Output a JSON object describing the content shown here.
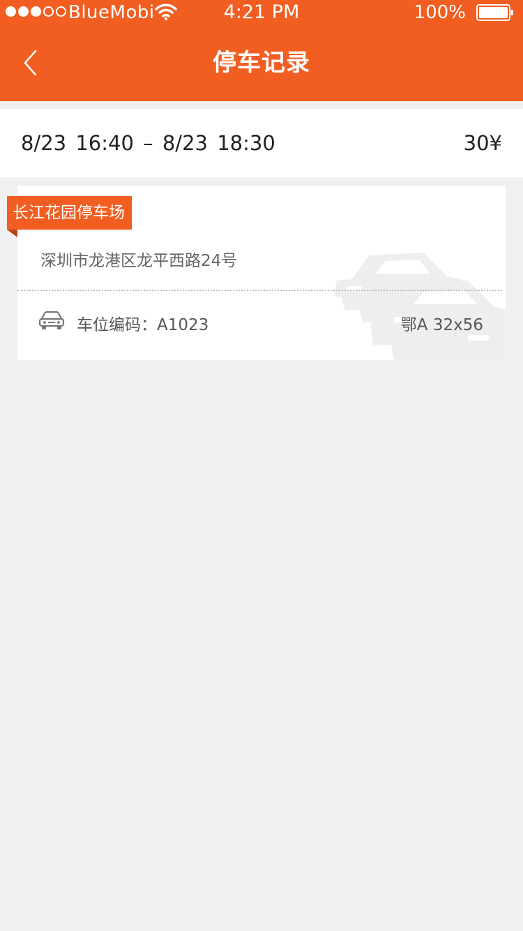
{
  "status_bar": {
    "carrier": "BlueMobi",
    "time": "4:21 PM",
    "battery": "100%",
    "battery_level": 1.0,
    "signal_bars": 3,
    "signal_total": 5
  },
  "nav": {
    "title": "停车记录",
    "back_icon": "chevron-left-icon"
  },
  "record": {
    "time_range": "8/23  16:40  –  8/23  18:30",
    "price": "30¥"
  },
  "card": {
    "lot_name": "长江花园停车场",
    "address": "深圳市龙港区龙平西路24号",
    "spot_label": "车位编码：A1023",
    "plate": "鄂A  32x56",
    "car_icon": "car-icon",
    "watermark_icon": "cars-watermark-icon"
  },
  "colors": {
    "accent": "#f25e22",
    "background": "#f0f0f0",
    "card": "#ffffff"
  }
}
